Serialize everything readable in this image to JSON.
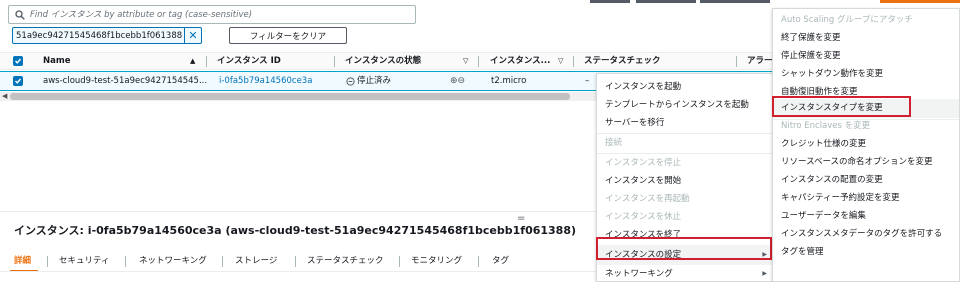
{
  "search": {
    "placeholder": "Find インスタンス by attribute or tag (case-sensitive)"
  },
  "filter": {
    "chip_value": "51a9ec94271545468f1bcebb1f061388",
    "clear_label": "フィルターをクリア"
  },
  "table": {
    "headers": {
      "name": "Name",
      "instance_id": "インスタンス ID",
      "state": "インスタンスの状態",
      "type": "インスタンス...",
      "status": "ステータスチェック",
      "alarm": "アラー"
    },
    "row": {
      "name": "aws-cloud9-test-51a9ec9427154545...",
      "instance_id": "i-0fa5b79a14560ce3a",
      "state": "停止済み",
      "type": "t2.micro",
      "status": "–"
    }
  },
  "details": {
    "title_prefix": "インスタンス: ",
    "title_id": "i-0fa5b79a14560ce3a",
    "title_name": "(aws-cloud9-test-51a9ec94271545468f1bcebb1f061388)"
  },
  "tabs": [
    "詳細",
    "セキュリティ",
    "ネットワーキング",
    "ストレージ",
    "ステータスチェック",
    "モニタリング",
    "タグ"
  ],
  "context_menu": [
    {
      "label": "インスタンスを起動",
      "disabled": false
    },
    {
      "label": "テンプレートからインスタンスを起動",
      "disabled": false
    },
    {
      "label": "サーバーを移行",
      "disabled": false
    },
    {
      "label": "接続",
      "disabled": true
    },
    {
      "label": "インスタンスを停止",
      "disabled": true
    },
    {
      "label": "インスタンスを開始",
      "disabled": false
    },
    {
      "label": "インスタンスを再起動",
      "disabled": true
    },
    {
      "label": "インスタンスを休止",
      "disabled": true
    },
    {
      "label": "インスタンスを終了",
      "disabled": false
    },
    {
      "label": "インスタンスの設定",
      "disabled": false
    },
    {
      "label": "ネットワーキング",
      "disabled": false
    }
  ],
  "submenu": [
    {
      "label": "Auto Scaling グループにアタッチ",
      "disabled": true
    },
    {
      "label": "終了保護を変更",
      "disabled": false
    },
    {
      "label": "停止保護を変更",
      "disabled": false
    },
    {
      "label": "シャットダウン動作を変更",
      "disabled": false
    },
    {
      "label": "自動復旧動作を変更",
      "disabled": false
    },
    {
      "label": "インスタンスタイプを変更",
      "disabled": false
    },
    {
      "label": "Nitro Enclaves を変更",
      "disabled": true
    },
    {
      "label": "クレジット仕様の変更",
      "disabled": false
    },
    {
      "label": "リソースベースの命名オプションを変更",
      "disabled": false
    },
    {
      "label": "インスタンスの配置の変更",
      "disabled": false
    },
    {
      "label": "キャパシティー予約設定を変更",
      "disabled": false
    },
    {
      "label": "ユーザーデータを編集",
      "disabled": false
    },
    {
      "label": "インスタンスメタデータのタグを許可する",
      "disabled": false
    },
    {
      "label": "タグを管理",
      "disabled": false
    }
  ],
  "colors": {
    "accent": "#ec7211",
    "link": "#0073bb",
    "highlight_border": "#d01f2e",
    "selected_row": "#f1faff"
  },
  "icons": {
    "search": "search-icon",
    "close": "close-icon",
    "checkbox": "checkbox-checked-icon",
    "stopped": "stopped-circle-icon",
    "zoom": "zoom-icon",
    "sort": "sort-up-icon",
    "filter_caret": "caret-down-icon",
    "submenu_arrow": "caret-right-icon"
  }
}
